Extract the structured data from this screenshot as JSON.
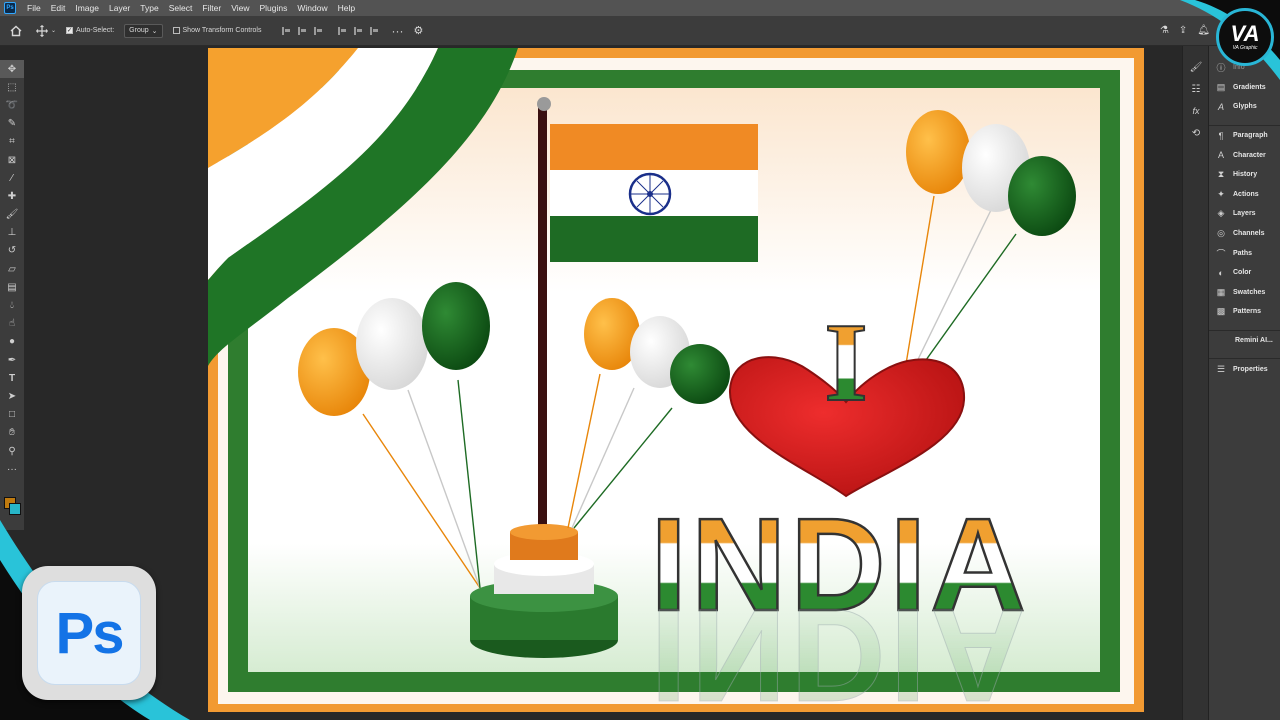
{
  "menubar": {
    "items": [
      "File",
      "Edit",
      "Image",
      "Layer",
      "Type",
      "Select",
      "Filter",
      "View",
      "Plugins",
      "Window",
      "Help"
    ]
  },
  "options": {
    "auto_select_label": "Auto-Select:",
    "auto_select_checked": true,
    "group_value": "Group",
    "transform_label": "Show Transform Controls",
    "transform_checked": false
  },
  "toolbar": {
    "tools": [
      "move-tool-icon",
      "marquee-tool-icon",
      "lasso-tool-icon",
      "quick-select-tool-icon",
      "crop-tool-icon",
      "frame-tool-icon",
      "eyedropper-tool-icon",
      "healing-brush-tool-icon",
      "brush-tool-icon",
      "clone-stamp-tool-icon",
      "history-brush-tool-icon",
      "eraser-tool-icon",
      "gradient-tool-icon",
      "blur-tool-icon",
      "smudge-tool-icon",
      "dodge-tool-icon",
      "pen-tool-icon",
      "type-tool-icon",
      "path-select-tool-icon",
      "rectangle-tool-icon",
      "hand-tool-icon",
      "zoom-tool-icon",
      "more-tools-icon"
    ],
    "foreground_color": "#c07b0f",
    "background_color": "#27b6c8"
  },
  "panels": {
    "group1": [
      {
        "label": "Info",
        "icon": "info-icon",
        "dim": true
      },
      {
        "label": "Gradients",
        "icon": "gradients-icon"
      },
      {
        "label": "Glyphs",
        "icon": "glyphs-icon"
      }
    ],
    "group2": [
      {
        "label": "Paragraph",
        "icon": "paragraph-icon"
      },
      {
        "label": "Character",
        "icon": "character-icon"
      },
      {
        "label": "History",
        "icon": "history-icon"
      },
      {
        "label": "Actions",
        "icon": "actions-icon"
      },
      {
        "label": "Layers",
        "icon": "layers-icon"
      },
      {
        "label": "Channels",
        "icon": "channels-icon"
      },
      {
        "label": "Paths",
        "icon": "paths-icon"
      },
      {
        "label": "Color",
        "icon": "color-icon"
      },
      {
        "label": "Swatches",
        "icon": "swatches-icon"
      },
      {
        "label": "Patterns",
        "icon": "patterns-icon"
      }
    ],
    "group3": [
      {
        "label": "Remini AI...",
        "icon": ""
      }
    ],
    "group4": [
      {
        "label": "Properties",
        "icon": "properties-icon"
      }
    ]
  },
  "artwork": {
    "heading_letter": "I",
    "word": "INDIA",
    "colors": {
      "saffron": "#f08a24",
      "white": "#ffffff",
      "green": "#1e6b24",
      "chakra": "#1a2f8a",
      "heart": "#d41c1c"
    }
  },
  "badge": {
    "text": "Ps"
  },
  "logo": {
    "text": "VA",
    "sub": "VA Graphic"
  }
}
